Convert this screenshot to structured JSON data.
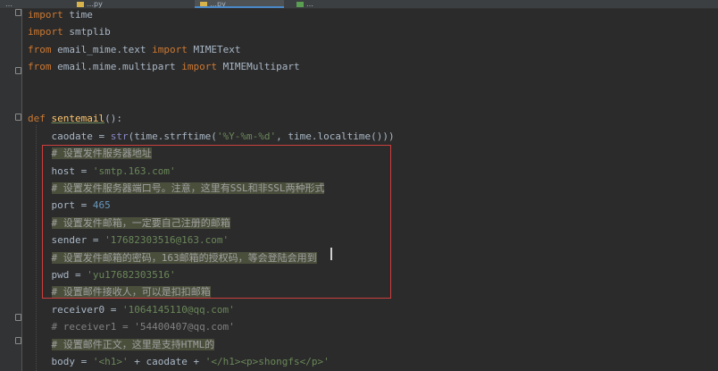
{
  "tabs": [
    "…",
    "…py",
    "…py",
    "…"
  ],
  "lines": [
    {
      "segments": [
        {
          "cls": "kw",
          "text": "import"
        },
        {
          "cls": "",
          "text": " time"
        }
      ]
    },
    {
      "segments": [
        {
          "cls": "kw",
          "text": "import"
        },
        {
          "cls": "",
          "text": " smtplib"
        }
      ]
    },
    {
      "segments": [
        {
          "cls": "kw",
          "text": "from"
        },
        {
          "cls": "",
          "text": " email_mime.text "
        },
        {
          "cls": "kw",
          "text": "import"
        },
        {
          "cls": "",
          "text": " MIMEText"
        }
      ]
    },
    {
      "segments": [
        {
          "cls": "kw",
          "text": "from"
        },
        {
          "cls": "",
          "text": " email.mime.multipart "
        },
        {
          "cls": "kw",
          "text": "import"
        },
        {
          "cls": "",
          "text": " MIMEMultipart"
        }
      ]
    },
    {
      "segments": []
    },
    {
      "segments": []
    },
    {
      "segments": [
        {
          "cls": "kw",
          "text": "def"
        },
        {
          "cls": "",
          "text": " "
        },
        {
          "cls": "fn",
          "text": "sentemail"
        },
        {
          "cls": "",
          "text": "():"
        }
      ]
    },
    {
      "segments": [
        {
          "cls": "",
          "text": "    caodate = "
        },
        {
          "cls": "bi",
          "text": "str"
        },
        {
          "cls": "",
          "text": "(time.strftime("
        },
        {
          "cls": "str",
          "text": "'%Y-%m-%d'"
        },
        {
          "cls": "",
          "text": ", time.localtime()))"
        }
      ]
    },
    {
      "segments": [
        {
          "cls": "",
          "text": "    "
        },
        {
          "cls": "cm",
          "text": "# 设置发件服务器地址"
        }
      ]
    },
    {
      "segments": [
        {
          "cls": "",
          "text": "    host = "
        },
        {
          "cls": "str",
          "text": "'smtp.163.com'"
        }
      ]
    },
    {
      "segments": [
        {
          "cls": "",
          "text": "    "
        },
        {
          "cls": "cm",
          "text": "# 设置发件服务器端口号。注意，这里有SSL和非SSL两种形式"
        }
      ]
    },
    {
      "segments": [
        {
          "cls": "",
          "text": "    port = "
        },
        {
          "cls": "num",
          "text": "465"
        }
      ]
    },
    {
      "segments": [
        {
          "cls": "",
          "text": "    "
        },
        {
          "cls": "cm",
          "text": "# 设置发件邮箱，一定要自己注册的邮箱"
        }
      ]
    },
    {
      "segments": [
        {
          "cls": "",
          "text": "    sender = "
        },
        {
          "cls": "str",
          "text": "'17682303516@163.com'"
        }
      ]
    },
    {
      "segments": [
        {
          "cls": "",
          "text": "    "
        },
        {
          "cls": "cm",
          "text": "# 设置发件邮箱的密码，163邮箱的授权码，等会登陆会用到"
        }
      ]
    },
    {
      "segments": [
        {
          "cls": "",
          "text": "    pwd = "
        },
        {
          "cls": "str",
          "text": "'yu17682303516'"
        }
      ]
    },
    {
      "segments": [
        {
          "cls": "",
          "text": "    "
        },
        {
          "cls": "cm",
          "text": "# 设置邮件接收人，可以是扣扣邮箱"
        }
      ]
    },
    {
      "segments": [
        {
          "cls": "",
          "text": "    receiver0 = "
        },
        {
          "cls": "str",
          "text": "'1064145110@qq.com'"
        }
      ]
    },
    {
      "segments": [
        {
          "cls": "",
          "text": "    "
        },
        {
          "cls": "cm-plain",
          "text": "# receiver1 = '54400407@qq.com'"
        }
      ]
    },
    {
      "segments": [
        {
          "cls": "",
          "text": "    "
        },
        {
          "cls": "cm",
          "text": "# 设置邮件正文，这里是支持HTML的"
        }
      ]
    },
    {
      "segments": [
        {
          "cls": "",
          "text": "    body = "
        },
        {
          "cls": "str",
          "text": "'<h1>'"
        },
        {
          "cls": "",
          "text": " + caodate + "
        },
        {
          "cls": "str",
          "text": "'</h1><p>shongfs</p>'"
        }
      ]
    }
  ]
}
